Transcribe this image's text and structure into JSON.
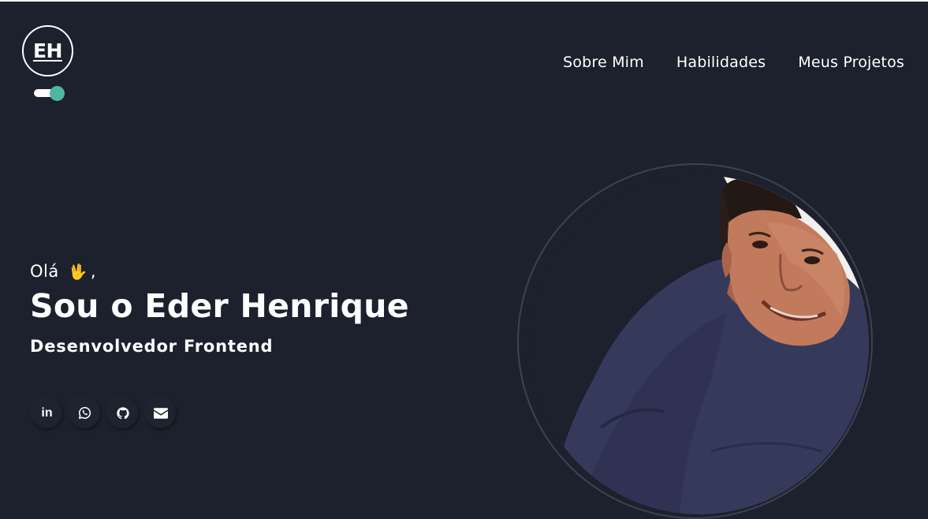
{
  "logo": {
    "initials": "EH"
  },
  "theme_toggle": {
    "accent": "#4db6a4"
  },
  "nav": {
    "items": [
      "Sobre Mim",
      "Habilidades",
      "Meus Projetos"
    ]
  },
  "hero": {
    "greeting": "Olá",
    "greeting_emoji": "vulcan-salute-icon",
    "greeting_suffix": ",",
    "title": "Sou o Eder Henrique",
    "role": "Desenvolvedor Frontend"
  },
  "socials": [
    {
      "icon": "linkedin-icon",
      "text": "in"
    },
    {
      "icon": "whatsapp-icon"
    },
    {
      "icon": "github-icon"
    },
    {
      "icon": "envelope-icon"
    }
  ],
  "colors": {
    "background": "#1c212d",
    "text": "#ffffff",
    "accent": "#4db6a4"
  }
}
